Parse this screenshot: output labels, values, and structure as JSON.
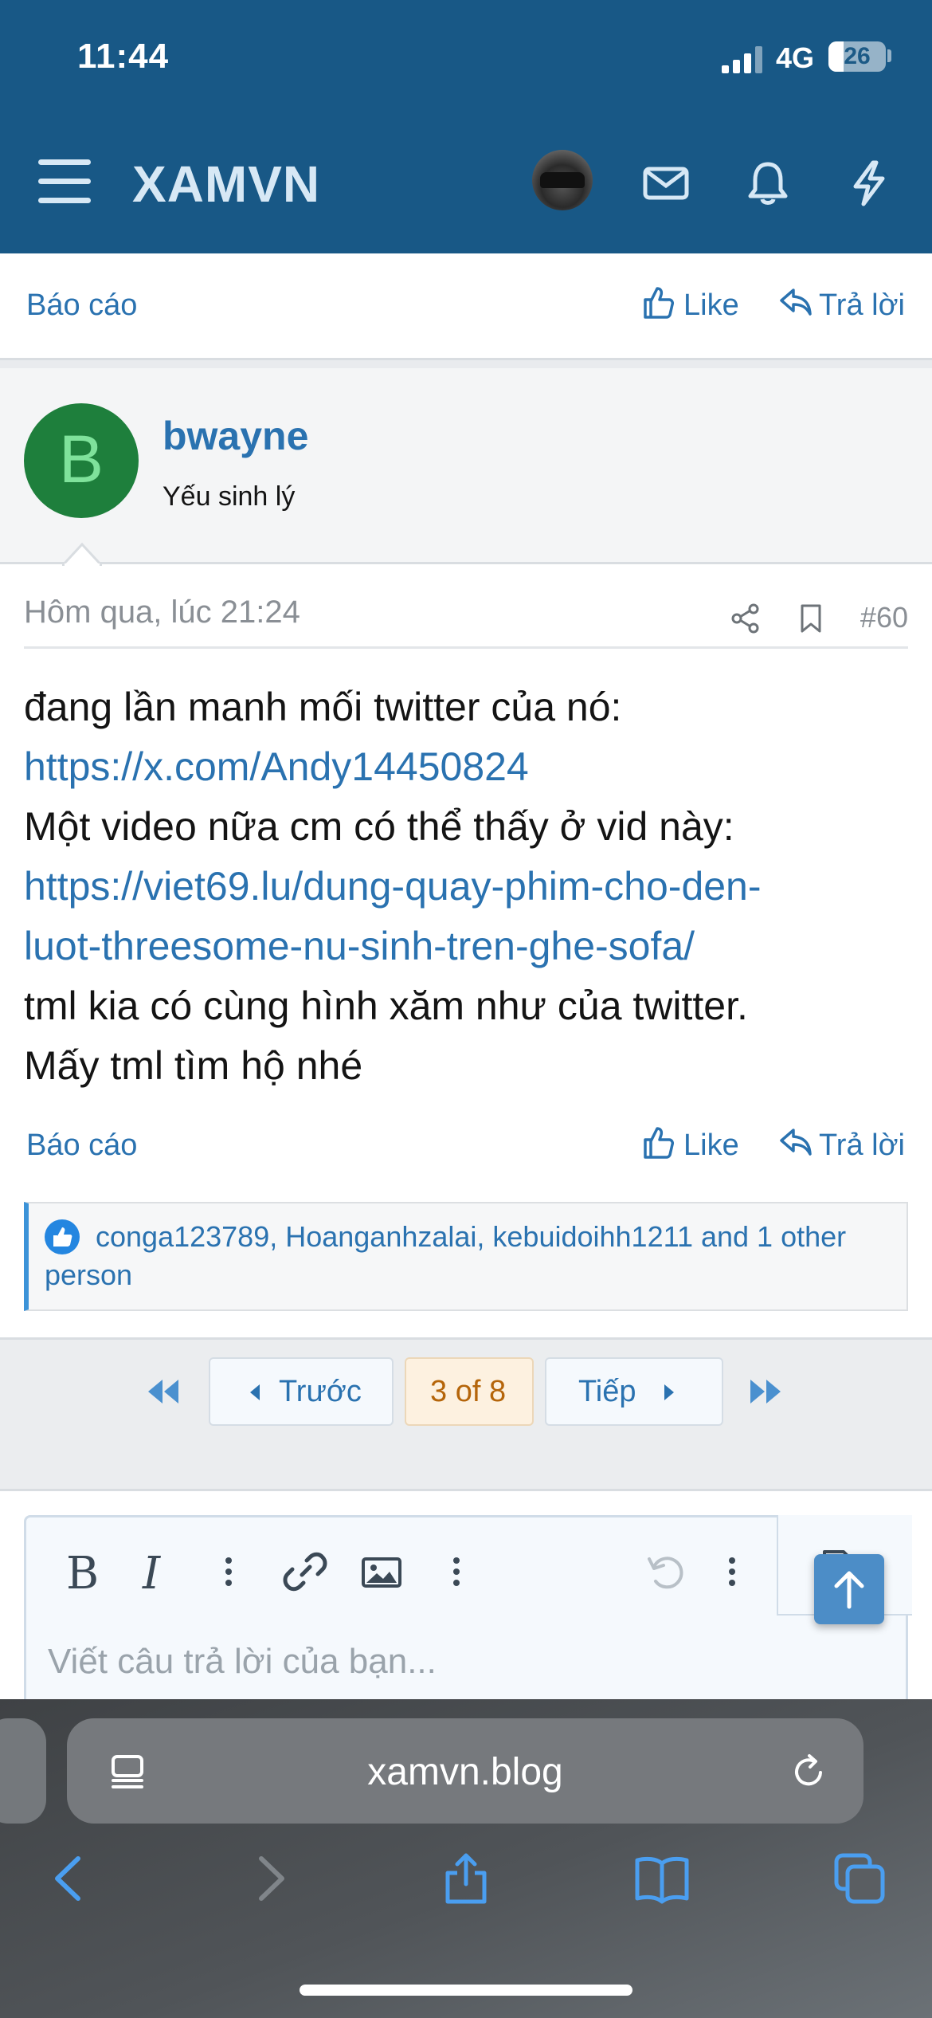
{
  "status_bar": {
    "time": "11:44",
    "network": "4G",
    "battery": "26"
  },
  "header": {
    "brand": "XAMVN"
  },
  "post_actions": {
    "report": "Báo cáo",
    "like": "Like",
    "reply": "Trả lời"
  },
  "message": {
    "avatar_letter": "B",
    "username": "bwayne",
    "user_title": "Yếu sinh lý",
    "date": "Hôm qua, lúc 21:24",
    "post_number": "#60",
    "body": {
      "line1": "đang lần manh mối twitter của nó:",
      "link1": "https://x.com/Andy14450824",
      "line2": "Một video nữa cm có thể thấy ở vid này:",
      "link2a": "https://viet69.lu/dung-quay-phim-cho-den-",
      "link2b": "luot-threesome-nu-sinh-tren-ghe-sofa/",
      "line3": "tml kia có cùng hình xăm như của twitter.",
      "line4": "Mấy tml tìm hộ nhé"
    },
    "likes_text": "conga123789, Hoanganhzalai, kebuidoihh1211 and 1 other person"
  },
  "pagination": {
    "prev": "Trước",
    "current": "3 of 8",
    "next": "Tiếp"
  },
  "editor": {
    "placeholder": "Viết câu trả lời của bạn..."
  },
  "browser": {
    "url": "xamvn.blog"
  },
  "colors": {
    "header_bg": "#185886",
    "link": "#2a72b0",
    "avatar_bg": "#1e7f3c",
    "current_page": "#b5650a"
  }
}
